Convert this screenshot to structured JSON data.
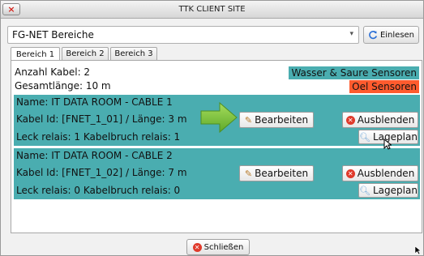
{
  "window": {
    "title": "TTK CLIENT SITE",
    "close_glyph": "×"
  },
  "combo": {
    "value": "FG-NET Bereiche",
    "arrow": "▾"
  },
  "einlesen_button": {
    "label": "Einlesen",
    "icon": "refresh-icon"
  },
  "tabs": [
    {
      "label": "Bereich 1",
      "active": true
    },
    {
      "label": "Bereich 2",
      "active": false
    },
    {
      "label": "Bereich 3",
      "active": false
    }
  ],
  "summary": {
    "cable_count": "Anzahl Kabel: 2",
    "total_length": "Gesamtlänge: 10 m",
    "badge_water": "Wasser & Saure Sensoren",
    "badge_oil": "Oel Sensoren"
  },
  "cables": [
    {
      "name": "Name: IT DATA ROOM - CABLE 1",
      "id_length": "Kabel Id: [FNET_1_01] / Länge: 3 m",
      "relais": "Leck relais: 1  Kabelbruch relais: 1"
    },
    {
      "name": "Name: IT DATA ROOM - CABLE 2",
      "id_length": "Kabel Id: [FNET_1_02] / Länge: 7 m",
      "relais": "Leck relais: 0  Kabelbruch relais: 0"
    }
  ],
  "buttons": {
    "edit": "Bearbeiten",
    "hide": "Ausblenden",
    "map": "Lageplan",
    "close": "Schließen"
  },
  "colors": {
    "cable_bg": "#4aadb0",
    "oil_badge": "#ff5b2e",
    "arrow_green": "#7ac43a"
  }
}
